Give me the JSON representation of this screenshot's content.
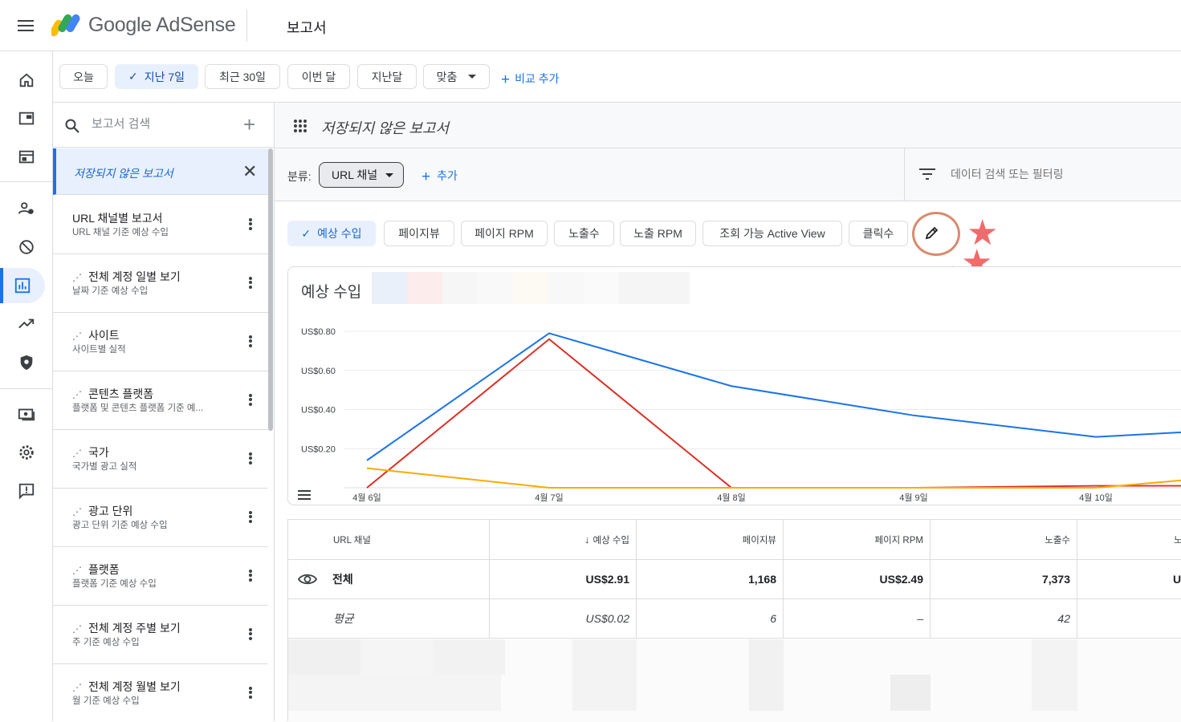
{
  "app": {
    "brand": "Google AdSense",
    "page_title": "보고서"
  },
  "rail": {
    "items": [
      {
        "icon": "home-icon"
      },
      {
        "icon": "ads-icon"
      },
      {
        "icon": "content-icon"
      },
      {
        "icon": "blocking-icon"
      },
      {
        "icon": "block-icon"
      },
      {
        "icon": "reports-icon"
      },
      {
        "icon": "optimization-icon"
      },
      {
        "icon": "privacy-icon"
      },
      {
        "icon": "payments-icon"
      },
      {
        "icon": "settings-icon"
      },
      {
        "icon": "feedback-icon"
      }
    ]
  },
  "date_filters": {
    "today": "오늘",
    "last7": "지난 7일",
    "last30": "최근 30일",
    "this_month": "이번 달",
    "last_month": "지난달",
    "custom": "맞춤",
    "add_compare": "비교 추가"
  },
  "reports_sidebar": {
    "search_placeholder": "보고서 검색",
    "active_report": "저장되지 않은 보고서",
    "items": [
      {
        "title": "URL 채널별 보고서",
        "subtitle": "URL 채널 기준 예상 수입",
        "icon": false
      },
      {
        "title": "전체 계정 일별 보기",
        "subtitle": "날짜 기준 예상 수입",
        "icon": true
      },
      {
        "title": "사이트",
        "subtitle": "사이트별 실적",
        "icon": true
      },
      {
        "title": "콘텐츠 플랫폼",
        "subtitle": "플랫폼 및 콘텐츠 플랫폼 기준 예...",
        "icon": true
      },
      {
        "title": "국가",
        "subtitle": "국가별 광고 실적",
        "icon": true
      },
      {
        "title": "광고 단위",
        "subtitle": "광고 단위 기준 예상 수입",
        "icon": true
      },
      {
        "title": "플랫폼",
        "subtitle": "플랫폼 기준 예상 수입",
        "icon": true
      },
      {
        "title": "전체 계정 주별 보기",
        "subtitle": "주 기준 예상 수입",
        "icon": true
      },
      {
        "title": "전체 계정 월별 보기",
        "subtitle": "월 기준 예상 수입",
        "icon": true
      }
    ]
  },
  "main": {
    "title": "저장되지 않은 보고서",
    "breakdown_label": "분류:",
    "breakdown_value": "URL 채널",
    "add_breakdown": "추가",
    "filter_placeholder": "데이터 검색 또는 필터링",
    "metrics": [
      {
        "label": "예상 수입",
        "selected": true
      },
      {
        "label": "페이지뷰",
        "selected": false
      },
      {
        "label": "페이지 RPM",
        "selected": false
      },
      {
        "label": "노출수",
        "selected": false
      },
      {
        "label": "노출 RPM",
        "selected": false
      },
      {
        "label": "조회 가능 Active View",
        "selected": false
      },
      {
        "label": "클릭수",
        "selected": false
      }
    ]
  },
  "chart_data": {
    "type": "line",
    "title": "예상 수입",
    "categories": [
      "4월 6일",
      "4월 7일",
      "4월 8일",
      "4월 9일",
      "4월 10일"
    ],
    "y_ticks": [
      "US$0.80",
      "US$0.60",
      "US$0.40",
      "US$0.20"
    ],
    "ylim": [
      0,
      0.8
    ],
    "series": [
      {
        "color": "#1a73e8",
        "values": [
          0.14,
          0.79,
          0.52,
          0.37,
          0.26,
          0.31
        ]
      },
      {
        "color": "#d93025",
        "values": [
          0.0,
          0.76,
          0.0,
          0.0,
          0.01,
          0.01
        ]
      },
      {
        "color": "#f9ab00",
        "values": [
          0.1,
          0.0,
          0.0,
          0.0,
          0.0,
          0.08
        ]
      }
    ]
  },
  "table": {
    "headers": [
      "URL 채널",
      "예상 수입",
      "페이지뷰",
      "페이지 RPM",
      "노출수"
    ],
    "sort_arrow": "↓",
    "total": {
      "label": "전체",
      "values": [
        "US$2.91",
        "1,168",
        "US$2.49",
        "7,373"
      ],
      "partial": "U"
    },
    "average": {
      "label": "평균",
      "values": [
        "US$0.02",
        "6",
        "–",
        "42"
      ]
    },
    "cut_header": "노"
  },
  "colors": {
    "accent": "#1a73e8",
    "selected_bg": "#e8f0fe",
    "star": "#f06b6b",
    "circle": "#d98a6d"
  }
}
